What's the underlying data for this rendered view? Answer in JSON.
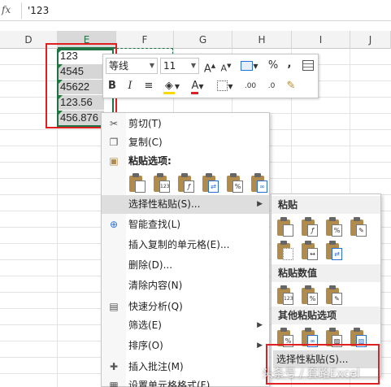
{
  "formula_bar": {
    "fx_label": "fx",
    "value": "'123"
  },
  "columns": [
    "D",
    "E",
    "F",
    "G",
    "H",
    "I",
    "J"
  ],
  "cells": [
    "123",
    "4545",
    "45622",
    "123.56",
    "456.876"
  ],
  "mini_toolbar": {
    "font_name": "等线",
    "font_size": "11",
    "increase_font": "A",
    "decrease_font": "A",
    "percent": "%",
    "comma": ",",
    "bold": "B",
    "italic": "I",
    "font_color": "A",
    "increase_decimal": ".00",
    "decrease_decimal": ".0"
  },
  "context_menu": {
    "cut": "剪切(T)",
    "copy": "复制(C)",
    "paste_options": "粘贴选项:",
    "paste_special": "选择性粘贴(S)...",
    "smart_lookup": "智能查找(L)",
    "insert_copied": "插入复制的单元格(E)...",
    "delete": "删除(D)...",
    "clear_contents": "清除内容(N)",
    "quick_analysis": "快速分析(Q)",
    "filter": "筛选(E)",
    "sort": "排序(O)",
    "insert_comment": "插入批注(M)",
    "format_cells": "设置单元格格式(F)..."
  },
  "submenu": {
    "paste": "粘贴",
    "paste_values": "粘贴数值",
    "other_paste": "其他粘贴选项",
    "paste_special": "选择性粘贴(S)..."
  },
  "icon_labels": {
    "values": "123"
  },
  "watermark": "头条号 / 套路Excel",
  "colors": {
    "excel_green": "#217346",
    "highlight_red": "#e02020",
    "font_color_red": "#e02020",
    "fill_yellow": "#ffd800"
  }
}
